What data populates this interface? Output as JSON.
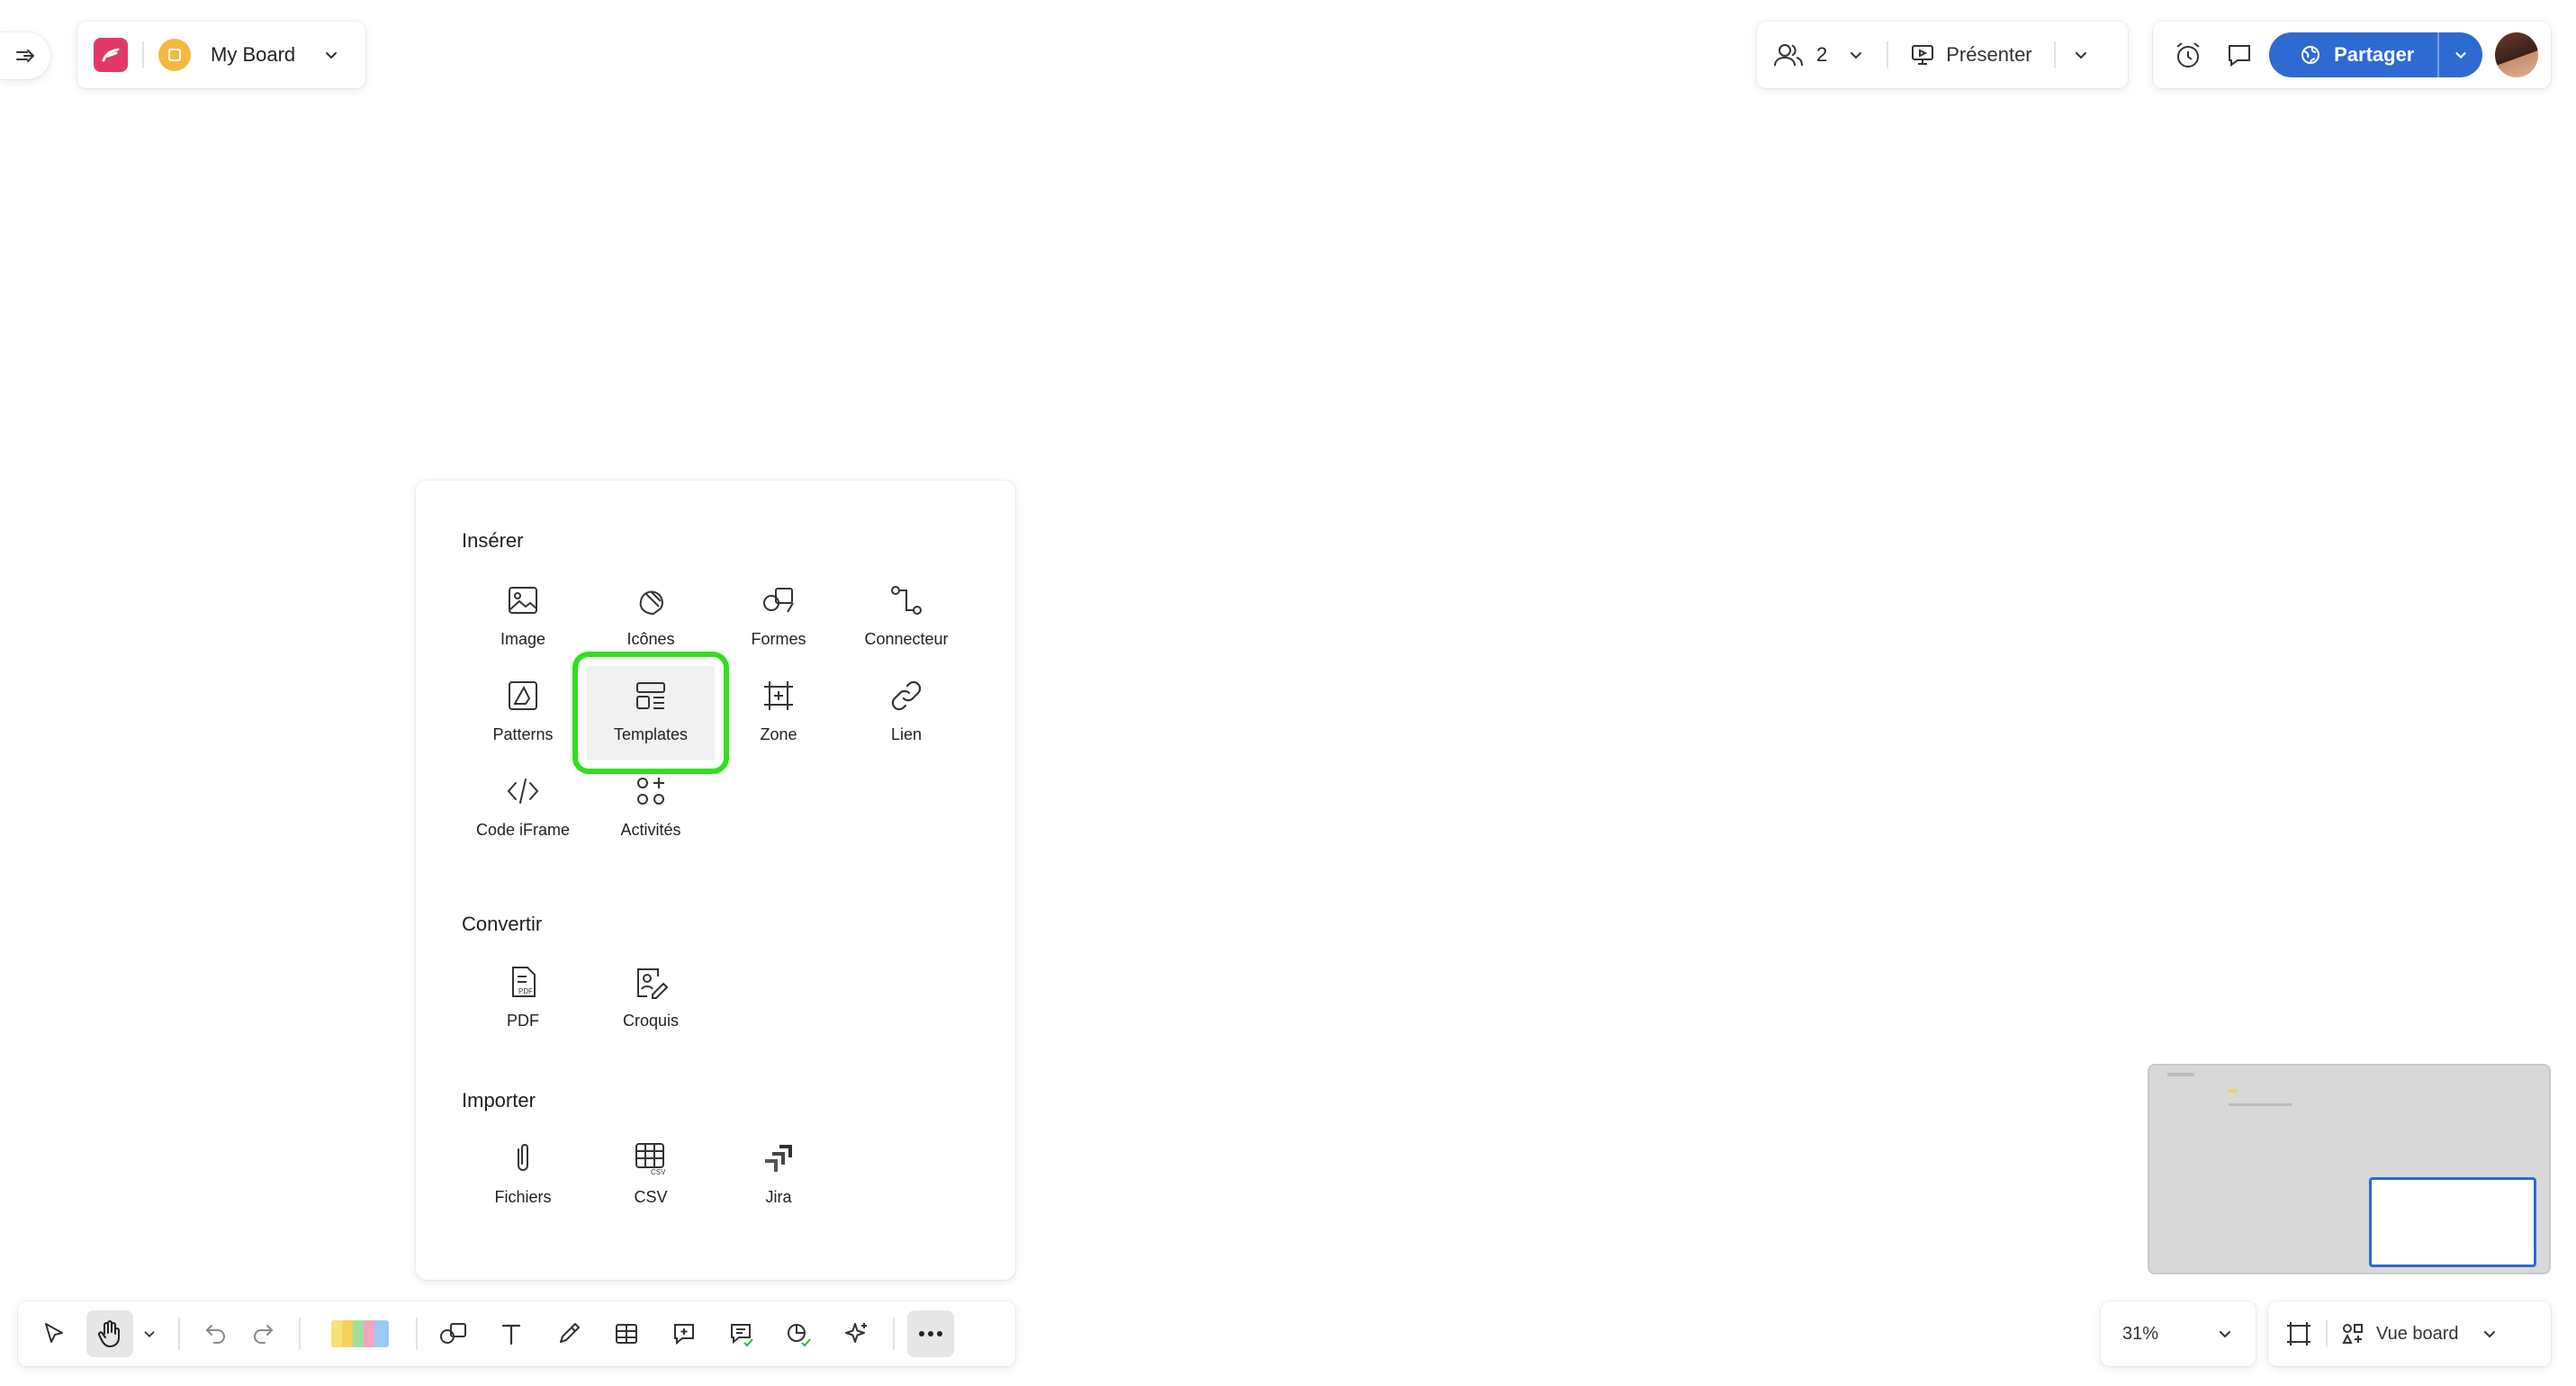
{
  "board": {
    "name": "My Board"
  },
  "collab": {
    "participants": "2",
    "present_label": "Présenter"
  },
  "share": {
    "label": "Partager"
  },
  "insert_panel": {
    "insert_title": "Insérer",
    "insert_items": [
      {
        "label": "Image",
        "icon": "image-icon"
      },
      {
        "label": "Icônes",
        "icon": "icons-icon"
      },
      {
        "label": "Formes",
        "icon": "shapes-icon"
      },
      {
        "label": "Connecteur",
        "icon": "connector-icon"
      },
      {
        "label": "Patterns",
        "icon": "patterns-icon"
      },
      {
        "label": "Templates",
        "icon": "templates-icon"
      },
      {
        "label": "Zone",
        "icon": "zone-icon"
      },
      {
        "label": "Lien",
        "icon": "link-icon"
      },
      {
        "label": "Code iFrame",
        "icon": "code-icon"
      },
      {
        "label": "Activités",
        "icon": "activities-icon"
      }
    ],
    "convert_title": "Convertir",
    "convert_items": [
      {
        "label": "PDF",
        "icon": "pdf-icon"
      },
      {
        "label": "Croquis",
        "icon": "sketch-icon"
      }
    ],
    "import_title": "Importer",
    "import_items": [
      {
        "label": "Fichiers",
        "icon": "paperclip-icon"
      },
      {
        "label": "CSV",
        "icon": "csv-icon"
      },
      {
        "label": "Jira",
        "icon": "jira-icon"
      }
    ]
  },
  "zoom": {
    "level": "31%"
  },
  "view": {
    "label": "Vue board"
  },
  "colors": {
    "accent": "#2d6ad1",
    "highlight": "#2fe01b",
    "brand": "#e4386b",
    "board_icon": "#f5b942"
  }
}
